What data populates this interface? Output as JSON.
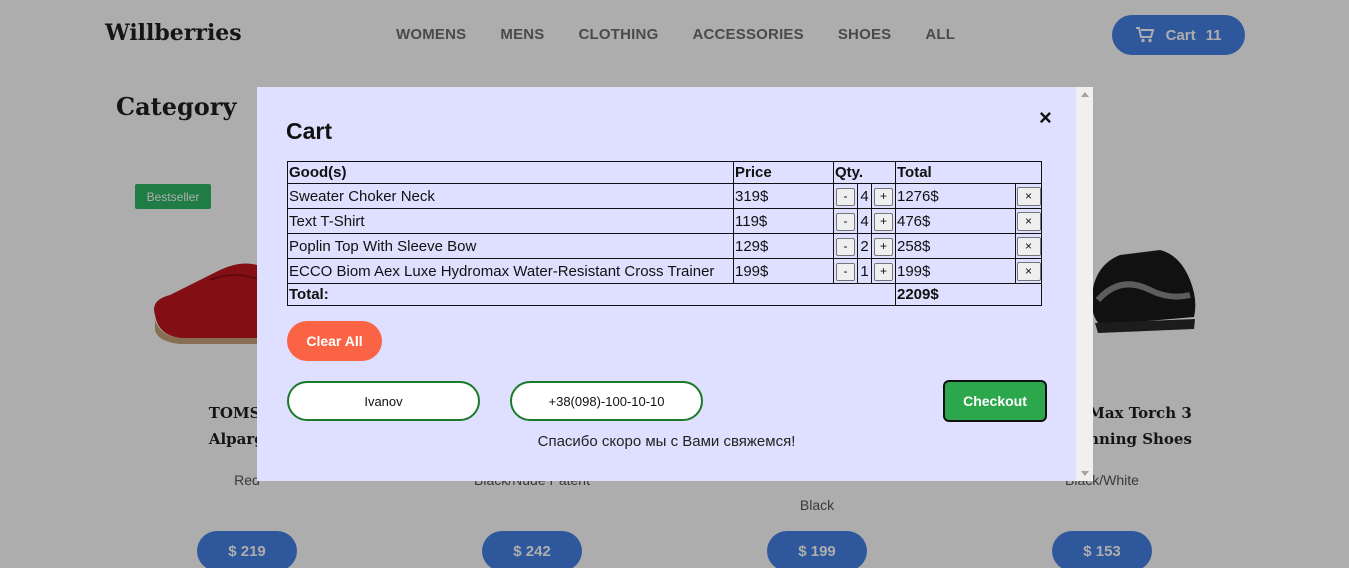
{
  "header": {
    "logo": "Willberries",
    "nav": [
      "WOMENS",
      "MENS",
      "CLOTHING",
      "ACCESSORIES",
      "SHOES",
      "ALL"
    ],
    "cart_label": "Cart",
    "cart_count": "11"
  },
  "category": {
    "title": "Category",
    "badge": "Bestseller",
    "products": [
      {
        "name_line1": "TOMS Wo",
        "name_line2": "Alpargata",
        "color": "Red",
        "price": "$ 219"
      },
      {
        "name_line1": "",
        "name_line2": "",
        "color": "Black/Nude Patent",
        "price": "$ 242"
      },
      {
        "name_line1": "",
        "name_line2": "",
        "color": "Black",
        "price": "$ 199"
      },
      {
        "name_line1": "Max Torch 3",
        "name_line2": "nning Shoes",
        "color": "Black/White",
        "price": "$ 153"
      }
    ]
  },
  "modal": {
    "title": "Cart",
    "close": "×",
    "table": {
      "headers": {
        "goods": "Good(s)",
        "price": "Price",
        "qty": "Qty.",
        "total": "Total"
      },
      "rows": [
        {
          "name": "Sweater Choker Neck",
          "price": "319$",
          "qty": "4",
          "total": "1276$"
        },
        {
          "name": "Text T-Shirt",
          "price": "119$",
          "qty": "4",
          "total": "476$"
        },
        {
          "name": "Poplin Top With Sleeve Bow",
          "price": "129$",
          "qty": "2",
          "total": "258$"
        },
        {
          "name": "ECCO Biom Aex Luxe Hydromax Water-Resistant Cross Trainer",
          "price": "199$",
          "qty": "1",
          "total": "199$"
        }
      ],
      "minus": "-",
      "plus": "+",
      "remove": "×",
      "total_label": "Total:",
      "total_value": "2209$"
    },
    "clear_all": "Clear All",
    "name_value": "Ivanov",
    "phone_value": "+38(098)-100-10-10",
    "checkout": "Checkout",
    "thanks": "Спасибо скоро мы с Вами свяжемся!"
  }
}
